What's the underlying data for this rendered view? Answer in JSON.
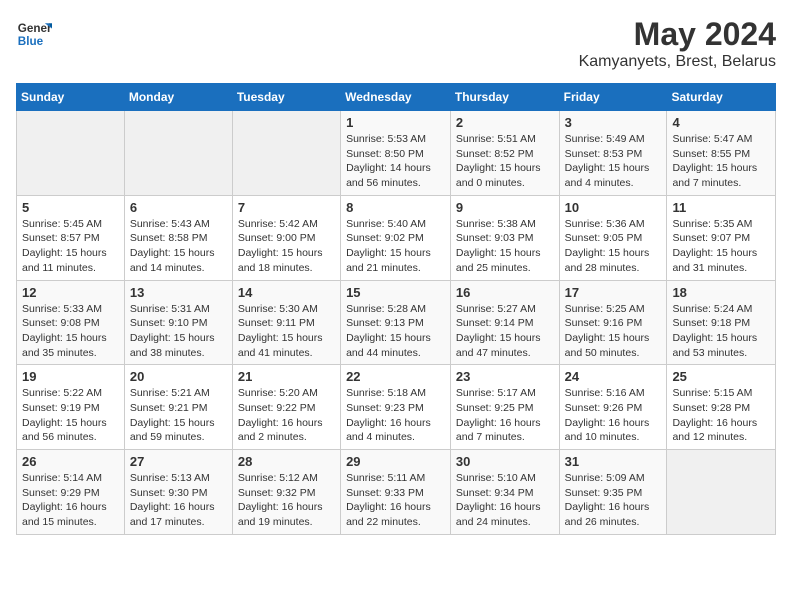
{
  "header": {
    "logo_general": "General",
    "logo_blue": "Blue",
    "month_title": "May 2024",
    "subtitle": "Kamyanyets, Brest, Belarus"
  },
  "days_of_week": [
    "Sunday",
    "Monday",
    "Tuesday",
    "Wednesday",
    "Thursday",
    "Friday",
    "Saturday"
  ],
  "weeks": [
    [
      {
        "day": "",
        "info": ""
      },
      {
        "day": "",
        "info": ""
      },
      {
        "day": "",
        "info": ""
      },
      {
        "day": "1",
        "info": "Sunrise: 5:53 AM\nSunset: 8:50 PM\nDaylight: 14 hours\nand 56 minutes."
      },
      {
        "day": "2",
        "info": "Sunrise: 5:51 AM\nSunset: 8:52 PM\nDaylight: 15 hours\nand 0 minutes."
      },
      {
        "day": "3",
        "info": "Sunrise: 5:49 AM\nSunset: 8:53 PM\nDaylight: 15 hours\nand 4 minutes."
      },
      {
        "day": "4",
        "info": "Sunrise: 5:47 AM\nSunset: 8:55 PM\nDaylight: 15 hours\nand 7 minutes."
      }
    ],
    [
      {
        "day": "5",
        "info": "Sunrise: 5:45 AM\nSunset: 8:57 PM\nDaylight: 15 hours\nand 11 minutes."
      },
      {
        "day": "6",
        "info": "Sunrise: 5:43 AM\nSunset: 8:58 PM\nDaylight: 15 hours\nand 14 minutes."
      },
      {
        "day": "7",
        "info": "Sunrise: 5:42 AM\nSunset: 9:00 PM\nDaylight: 15 hours\nand 18 minutes."
      },
      {
        "day": "8",
        "info": "Sunrise: 5:40 AM\nSunset: 9:02 PM\nDaylight: 15 hours\nand 21 minutes."
      },
      {
        "day": "9",
        "info": "Sunrise: 5:38 AM\nSunset: 9:03 PM\nDaylight: 15 hours\nand 25 minutes."
      },
      {
        "day": "10",
        "info": "Sunrise: 5:36 AM\nSunset: 9:05 PM\nDaylight: 15 hours\nand 28 minutes."
      },
      {
        "day": "11",
        "info": "Sunrise: 5:35 AM\nSunset: 9:07 PM\nDaylight: 15 hours\nand 31 minutes."
      }
    ],
    [
      {
        "day": "12",
        "info": "Sunrise: 5:33 AM\nSunset: 9:08 PM\nDaylight: 15 hours\nand 35 minutes."
      },
      {
        "day": "13",
        "info": "Sunrise: 5:31 AM\nSunset: 9:10 PM\nDaylight: 15 hours\nand 38 minutes."
      },
      {
        "day": "14",
        "info": "Sunrise: 5:30 AM\nSunset: 9:11 PM\nDaylight: 15 hours\nand 41 minutes."
      },
      {
        "day": "15",
        "info": "Sunrise: 5:28 AM\nSunset: 9:13 PM\nDaylight: 15 hours\nand 44 minutes."
      },
      {
        "day": "16",
        "info": "Sunrise: 5:27 AM\nSunset: 9:14 PM\nDaylight: 15 hours\nand 47 minutes."
      },
      {
        "day": "17",
        "info": "Sunrise: 5:25 AM\nSunset: 9:16 PM\nDaylight: 15 hours\nand 50 minutes."
      },
      {
        "day": "18",
        "info": "Sunrise: 5:24 AM\nSunset: 9:18 PM\nDaylight: 15 hours\nand 53 minutes."
      }
    ],
    [
      {
        "day": "19",
        "info": "Sunrise: 5:22 AM\nSunset: 9:19 PM\nDaylight: 15 hours\nand 56 minutes."
      },
      {
        "day": "20",
        "info": "Sunrise: 5:21 AM\nSunset: 9:21 PM\nDaylight: 15 hours\nand 59 minutes."
      },
      {
        "day": "21",
        "info": "Sunrise: 5:20 AM\nSunset: 9:22 PM\nDaylight: 16 hours\nand 2 minutes."
      },
      {
        "day": "22",
        "info": "Sunrise: 5:18 AM\nSunset: 9:23 PM\nDaylight: 16 hours\nand 4 minutes."
      },
      {
        "day": "23",
        "info": "Sunrise: 5:17 AM\nSunset: 9:25 PM\nDaylight: 16 hours\nand 7 minutes."
      },
      {
        "day": "24",
        "info": "Sunrise: 5:16 AM\nSunset: 9:26 PM\nDaylight: 16 hours\nand 10 minutes."
      },
      {
        "day": "25",
        "info": "Sunrise: 5:15 AM\nSunset: 9:28 PM\nDaylight: 16 hours\nand 12 minutes."
      }
    ],
    [
      {
        "day": "26",
        "info": "Sunrise: 5:14 AM\nSunset: 9:29 PM\nDaylight: 16 hours\nand 15 minutes."
      },
      {
        "day": "27",
        "info": "Sunrise: 5:13 AM\nSunset: 9:30 PM\nDaylight: 16 hours\nand 17 minutes."
      },
      {
        "day": "28",
        "info": "Sunrise: 5:12 AM\nSunset: 9:32 PM\nDaylight: 16 hours\nand 19 minutes."
      },
      {
        "day": "29",
        "info": "Sunrise: 5:11 AM\nSunset: 9:33 PM\nDaylight: 16 hours\nand 22 minutes."
      },
      {
        "day": "30",
        "info": "Sunrise: 5:10 AM\nSunset: 9:34 PM\nDaylight: 16 hours\nand 24 minutes."
      },
      {
        "day": "31",
        "info": "Sunrise: 5:09 AM\nSunset: 9:35 PM\nDaylight: 16 hours\nand 26 minutes."
      },
      {
        "day": "",
        "info": ""
      }
    ]
  ]
}
